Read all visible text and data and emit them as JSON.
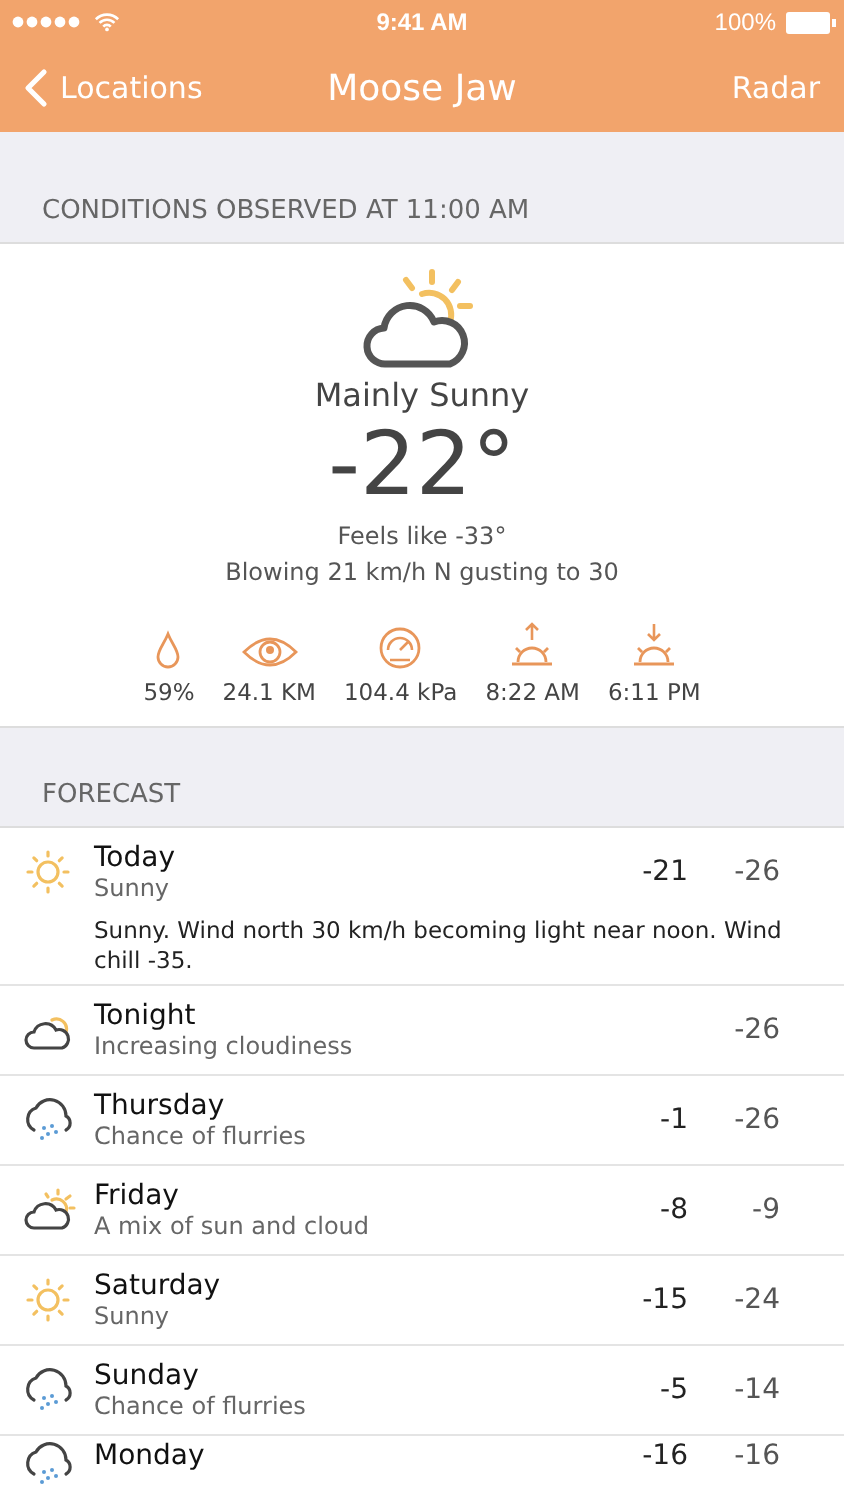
{
  "status_bar": {
    "time": "9:41 AM",
    "battery": "100%"
  },
  "nav": {
    "back": "Locations",
    "title": "Moose Jaw",
    "action": "Radar"
  },
  "conditions": {
    "header": "CONDITIONS OBSERVED AT 11:00 AM",
    "kind": "partly-cloudy",
    "summary": "Mainly Sunny",
    "temperature": "-22°",
    "feels_like": "Feels like -33°",
    "wind": "Blowing 21 km/h N gusting to 30",
    "details": [
      {
        "kind": "humidity",
        "value": "59%"
      },
      {
        "kind": "visibility",
        "value": "24.1 KM"
      },
      {
        "kind": "pressure",
        "value": "104.4 kPa"
      },
      {
        "kind": "sunrise",
        "value": "8:22 AM"
      },
      {
        "kind": "sunset",
        "value": "6:11 PM"
      }
    ]
  },
  "forecast": {
    "header": "FORECAST",
    "days": [
      {
        "kind": "sunny",
        "day": "Today",
        "summary": "Sunny",
        "high": "-21",
        "low": "-26",
        "details": "Sunny. Wind north 30 km/h becoming light near noon. Wind chill -35."
      },
      {
        "kind": "cloud-small-sun",
        "day": "Tonight",
        "summary": "Increasing cloudiness",
        "low": "-26"
      },
      {
        "kind": "flurries",
        "day": "Thursday",
        "summary": "Chance of flurries",
        "high": "-1",
        "low": "-26"
      },
      {
        "kind": "partly-cloudy",
        "day": "Friday",
        "summary": "A mix of sun and cloud",
        "high": "-8",
        "low": "-9"
      },
      {
        "kind": "sunny",
        "day": "Saturday",
        "summary": "Sunny",
        "high": "-15",
        "low": "-24"
      },
      {
        "kind": "flurries",
        "day": "Sunday",
        "summary": "Chance of flurries",
        "high": "-5",
        "low": "-14"
      },
      {
        "kind": "flurries",
        "day": "Monday",
        "high": "-16",
        "low": "-16"
      }
    ]
  }
}
